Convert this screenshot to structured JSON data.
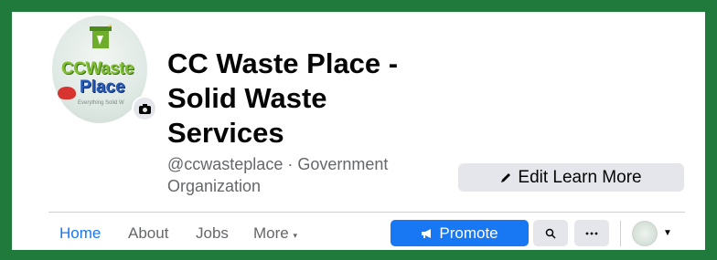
{
  "page": {
    "avatar_text": [
      "CCWaste",
      "Place",
      "Everything Solid W"
    ],
    "title": "CC Waste Place - Solid Waste Services",
    "handle_category": "@ccwasteplace · Government Organization",
    "edit_button_label": "Edit Learn More"
  },
  "nav": {
    "tabs": [
      {
        "label": "Home",
        "active": true
      },
      {
        "label": "About",
        "active": false
      },
      {
        "label": "Jobs",
        "active": false
      },
      {
        "label": "More",
        "active": false
      }
    ],
    "promote_label": "Promote"
  },
  "colors": {
    "frame": "#1f7a3b",
    "accent": "#1877f2",
    "button_gray": "#e4e6eb"
  },
  "icons": [
    "camera-icon",
    "pencil-icon",
    "megaphone-icon",
    "search-icon",
    "ellipsis-icon",
    "caret-down-icon"
  ]
}
